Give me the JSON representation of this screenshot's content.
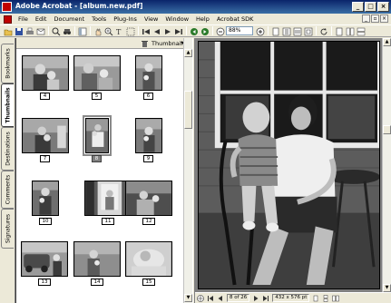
{
  "window": {
    "title": "Adobe Acrobat - [album.new.pdf]",
    "controls": [
      "_",
      "□",
      "×"
    ]
  },
  "menu": {
    "items": [
      "File",
      "Edit",
      "Document",
      "Tools",
      "Plug-Ins",
      "View",
      "Window",
      "Help",
      "Acrobat SDK"
    ]
  },
  "toolbar": {
    "zoom_value": "88%"
  },
  "left_tabs": [
    "Bookmarks",
    "Thumbnails",
    "Destinations",
    "Comments",
    "Signatures"
  ],
  "thumbnails": {
    "header_label": "Thumbnail",
    "pages": [
      {
        "label": "4"
      },
      {
        "label": "5"
      },
      {
        "label": "6"
      },
      {
        "label": "7"
      },
      {
        "label": "8"
      },
      {
        "label": "9"
      },
      {
        "label": "10"
      },
      {
        "label": "11"
      },
      {
        "label": "12"
      },
      {
        "label": "13"
      },
      {
        "label": "14"
      },
      {
        "label": "15"
      }
    ],
    "selected_page": "8"
  },
  "status": {
    "page_indicator": "8 of 26",
    "page_size": "432 x 576 pt"
  }
}
